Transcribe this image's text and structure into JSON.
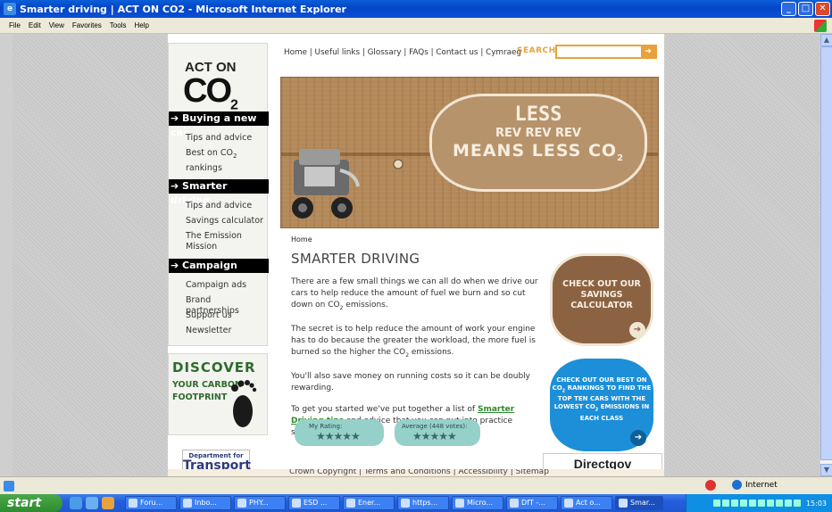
{
  "window": {
    "title": "Smarter driving | ACT ON CO2 - Microsoft Internet Explorer"
  },
  "menu": [
    "File",
    "Edit",
    "View",
    "Favorites",
    "Tools",
    "Help"
  ],
  "logo": {
    "line1": "ACT ON",
    "line2": "CO",
    "sub": "2"
  },
  "nav": {
    "buying_head": "➔ Buying a new car",
    "buying_items": [
      "Tips and advice",
      "Best on CO",
      "rankings"
    ],
    "smarter_head": "➔ Smarter driving",
    "smarter_items": [
      "Tips and advice",
      "Savings calculator",
      "The Emission",
      "Mission"
    ],
    "campaign_head": "➔ Campaign",
    "campaign_items": [
      "Campaign ads",
      "Brand partnerships",
      "Support us",
      "Newsletter"
    ]
  },
  "discover": {
    "line1": "DISCOVER",
    "line2": "YOUR CARBON",
    "line3": "FOOTPRINT"
  },
  "dft": {
    "small": "Department for",
    "big": "Transport"
  },
  "toplinks": "Home | Useful links | Glossary | FAQs | Contact us | Cymraeg",
  "search": {
    "label": "SEARCH",
    "placeholder": "",
    "button": "➔"
  },
  "banner": {
    "line1": "LESS",
    "line2": "REV REV REV",
    "line3": "MEANS LESS CO",
    "sub": "2"
  },
  "content": {
    "breadcrumb": "Home",
    "title": "SMARTER DRIVING",
    "p1a": "There are a few small things we can all do when we drive our cars to help reduce the amount of fuel we burn and so cut down on CO",
    "p1b": " emissions.",
    "p2a": "The secret is to help reduce the amount of work your engine has to do because the greater the workload, the more fuel is burned so the higher the CO",
    "p2b": " emissions.",
    "p3": "You'll also save money on running costs so it can be doubly rewarding.",
    "p4a": "To get you started we've put together a list of ",
    "p4link": "Smarter Driving tips",
    "p4b": " and advice that you can put into practice straight away."
  },
  "rating": {
    "my_label": "My Rating:",
    "my_stars": "★★★★★",
    "avg_label": "Average (448 votes):",
    "avg_stars": "★★★★★"
  },
  "promo1": {
    "text": "CHECK OUT OUR SAVINGS CALCULATOR",
    "go": "➔"
  },
  "promo2": {
    "text_a": "CHECK OUT OUR BEST ON CO",
    "text_b": " RANKINGS TO FIND THE TOP TEN CARS WITH THE LOWEST CO",
    "text_c": " EMISSIONS IN EACH CLASS",
    "go": "➔"
  },
  "directgov": "Directgov",
  "footer": "Crown Copyright | Terms and Conditions | Accessibility | Sitemap",
  "status": {
    "zone": "Internet"
  },
  "taskbar": {
    "start": "start",
    "tasks": [
      "Foru...",
      "Inbo...",
      "PHY...",
      "ESD ...",
      "Ener...",
      "https...",
      "Micro...",
      "DfT -...",
      "Act o...",
      "Smar..."
    ],
    "clock": "15:03"
  }
}
